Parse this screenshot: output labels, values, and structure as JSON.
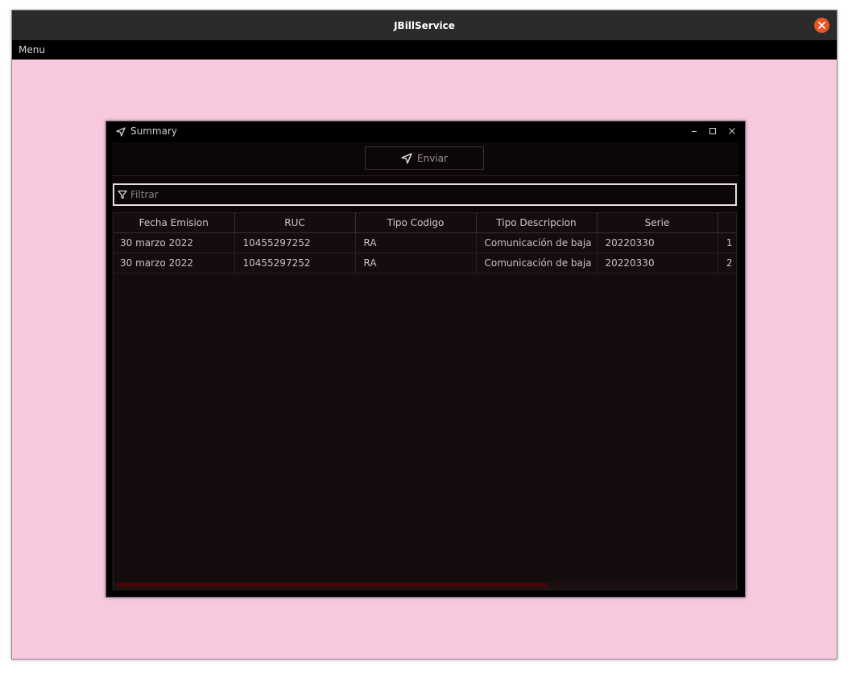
{
  "app": {
    "title": "JBillService",
    "menu": [
      "Menu"
    ]
  },
  "frame": {
    "title": "Summary",
    "send_label": "Enviar",
    "filter_placeholder": "Filtrar"
  },
  "table": {
    "columns": [
      "Fecha Emision",
      "RUC",
      "Tipo Codigo",
      "Tipo Descripcion",
      "Serie",
      ""
    ],
    "rows": [
      [
        "30 marzo 2022",
        "10455297252",
        "RA",
        "Comunicación de baja",
        "20220330",
        "1"
      ],
      [
        "30 marzo 2022",
        "10455297252",
        "RA",
        "Comunicación de baja",
        "20220330",
        "2"
      ]
    ]
  },
  "icons": {
    "close": "close-icon",
    "send": "send-icon",
    "filter": "filter-icon",
    "minimize": "minimize-icon",
    "maximize": "maximize-icon"
  },
  "colors": {
    "desktop": "#f8c8df",
    "accent_close": "#e95420",
    "scroll_thumb": "#4a0606"
  }
}
